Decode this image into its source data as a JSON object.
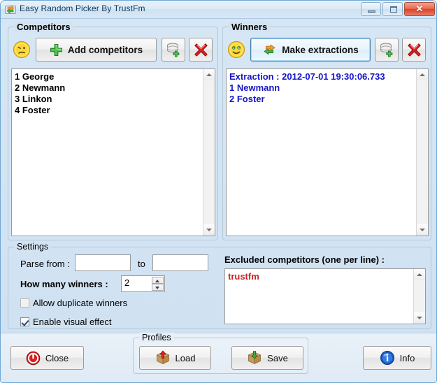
{
  "window": {
    "title": "Easy Random Picker By TrustFm",
    "icon": "recycle-arrows-icon",
    "buttons": {
      "minimize": "minimize-icon",
      "restore": "restore-icon",
      "close": "✕"
    }
  },
  "competitors": {
    "group_label": "Competitors",
    "mood_icon": "confused-smiley-icon",
    "add_button": "Add competitors",
    "save_list_button_icon": "database-add-icon",
    "clear_button_icon": "red-x-icon",
    "lines": "1 George\n2 Newmann\n3 Linkon\n4 Foster",
    "items": [
      {
        "index": "1",
        "name": "George"
      },
      {
        "index": "2",
        "name": "Newmann"
      },
      {
        "index": "3",
        "name": "Linkon"
      },
      {
        "index": "4",
        "name": "Foster"
      }
    ]
  },
  "winners": {
    "group_label": "Winners",
    "mood_icon": "money-eyes-smiley-icon",
    "extract_button": "Make extractions",
    "save_list_button_icon": "database-add-icon",
    "clear_button_icon": "red-x-icon",
    "lines": "Extraction : 2012-07-01 19:30:06.733\n1 Newmann\n2 Foster",
    "extraction_header": "Extraction : 2012-07-01 19:30:06.733",
    "items": [
      {
        "index": "1",
        "name": "Newmann"
      },
      {
        "index": "2",
        "name": "Foster"
      }
    ],
    "text_color": "#1515c8"
  },
  "settings": {
    "group_label": "Settings",
    "parse_from_label": "Parse from :",
    "parse_from_value": "",
    "to_label": "to",
    "parse_to_value": "",
    "how_many_label": "How many winners :",
    "how_many_value": "2",
    "allow_duplicates_label": "Allow duplicate winners",
    "allow_duplicates_checked": false,
    "visual_effect_label": "Enable visual effect",
    "visual_effect_checked": true
  },
  "excluded": {
    "label": "Excluded competitors (one per line) :",
    "value": "trustfm",
    "text_color": "#cc2222"
  },
  "footer": {
    "close_button": "Close",
    "profiles_group_label": "Profiles",
    "load_button": "Load",
    "save_button": "Save",
    "info_button": "Info"
  }
}
